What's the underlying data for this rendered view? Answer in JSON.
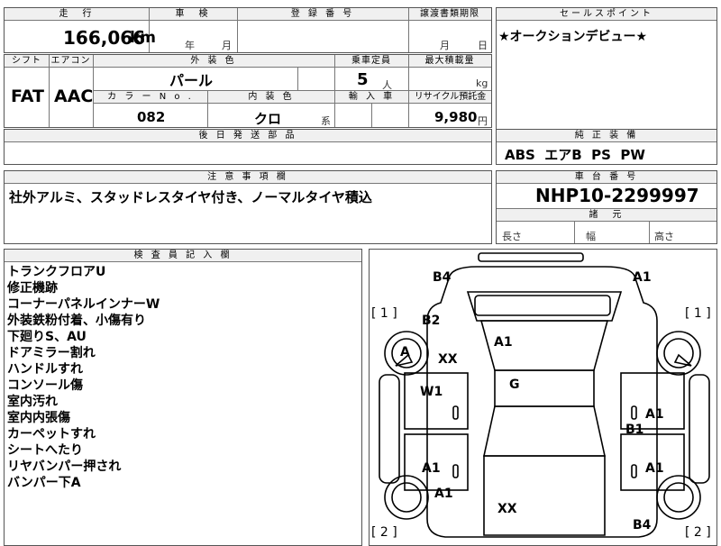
{
  "top_fragment": "",
  "row1": {
    "mileage_hdr": "走　行",
    "mileage": "166,066",
    "mileage_unit": "km",
    "inspection_hdr": "車　検",
    "inspection_year": "年",
    "inspection_month": "月",
    "reg_hdr": "登 録 番 号",
    "transfer_hdr": "譲渡書類期限",
    "transfer_month": "月",
    "transfer_day": "日"
  },
  "sales_point": {
    "hdr": "セールスポイント",
    "text": "★オークションデビュー★"
  },
  "row2": {
    "shift_hdr": "シフト",
    "ac_hdr": "エアコン",
    "shift": "FAT",
    "ac": "AAC",
    "exterior_hdr": "外 装 色",
    "exterior": "パール",
    "capacity_hdr": "乗車定員",
    "capacity": "5",
    "capacity_unit": "人",
    "load_hdr": "最大積載量",
    "load_unit": "kg",
    "color_no_hdr": "カ ラ ー N o .",
    "color_no": "082",
    "interior_hdr": "内 装 色",
    "interior": "クロ",
    "interior_suffix": "系",
    "import_hdr": "輸 入 車",
    "recycle_hdr": "リサイクル預託金",
    "recycle": "9,980",
    "recycle_unit": "円"
  },
  "later_parts": {
    "hdr": "後 日 発 送 部 品"
  },
  "equipment": {
    "hdr": "純 正 装 備",
    "text": "ABS  エアB  PS  PW"
  },
  "notes": {
    "hdr": "注 意 事 項 欄",
    "text": "社外アルミ、スタッドレスタイヤ付き、ノーマルタイヤ積込"
  },
  "chassis": {
    "hdr": "車 台 番 号",
    "number": "NHP10-2299997",
    "dims_hdr": "諸　元",
    "length": "長さ",
    "width": "幅",
    "height": "高さ"
  },
  "inspector": {
    "hdr": "検 査 員 記 入 欄",
    "lines": [
      "トランクフロアU",
      "修正機跡",
      "コーナーパネルインナーW",
      "外装鉄粉付着、小傷有り",
      "下廻りS、AU",
      "ドアミラー割れ",
      "ハンドルすれ",
      "コンソール傷",
      "室内汚れ",
      "室内内張傷",
      "カーペットすれ",
      "シートへたり",
      "リヤバンパー押され",
      "バンパー下A"
    ]
  },
  "diagram": {
    "marks": [
      {
        "label": "B4",
        "id": "b4-rear-left"
      },
      {
        "label": "A1",
        "id": "a1-rear-right"
      },
      {
        "label": "B2",
        "id": "b2-rear-fender-left"
      },
      {
        "label": "A1",
        "id": "a1-trunk"
      },
      {
        "label": "A",
        "id": "a-rear-wheel-left"
      },
      {
        "label": "XX",
        "id": "xx-rear-left"
      },
      {
        "label": "G",
        "id": "g-rear-glass"
      },
      {
        "label": "W1",
        "id": "w1-left-door"
      },
      {
        "label": "A1",
        "id": "a1-right-door-upper"
      },
      {
        "label": "B1",
        "id": "b1-right-door"
      },
      {
        "label": "A1",
        "id": "a1-left-door-lower"
      },
      {
        "label": "A1",
        "id": "a1-right-door-lower"
      },
      {
        "label": "A1",
        "id": "a1-front-left"
      },
      {
        "label": "XX",
        "id": "xx-front"
      },
      {
        "label": "B4",
        "id": "b4-front-right"
      }
    ],
    "side_labels": [
      "[ 1 ]",
      "[ 1 ]",
      "[ 2 ]",
      "[ 2 ]"
    ]
  }
}
